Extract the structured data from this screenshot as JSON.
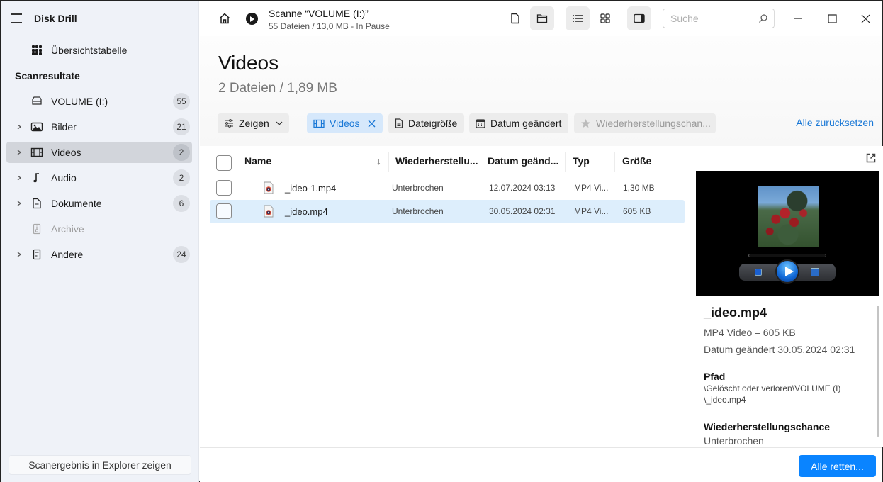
{
  "app": {
    "title": "Disk Drill"
  },
  "sidebar": {
    "overview_label": "Übersichtstabelle",
    "section_label": "Scanresultate",
    "items": [
      {
        "label": "VOLUME (I:)",
        "count": "55",
        "icon": "drive-icon",
        "expandable": false
      },
      {
        "label": "Bilder",
        "count": "21",
        "icon": "image-icon",
        "expandable": true
      },
      {
        "label": "Videos",
        "count": "2",
        "icon": "film-icon",
        "expandable": true,
        "active": true
      },
      {
        "label": "Audio",
        "count": "2",
        "icon": "music-note-icon",
        "expandable": true
      },
      {
        "label": "Dokumente",
        "count": "6",
        "icon": "document-icon",
        "expandable": true
      },
      {
        "label": "Archive",
        "count": "",
        "icon": "archive-icon",
        "expandable": false,
        "disabled": true
      },
      {
        "label": "Andere",
        "count": "24",
        "icon": "other-file-icon",
        "expandable": true
      }
    ],
    "explorer_button": "Scanergebnis in Explorer zeigen"
  },
  "topbar": {
    "scan_title": "Scanne “VOLUME (I:)”",
    "scan_status": "55 Dateien / 13,0 MB - In Pause",
    "search_placeholder": "Suche"
  },
  "main": {
    "title": "Videos",
    "subtitle": "2 Dateien / 1,89 MB",
    "filters": {
      "show": "Zeigen",
      "videos": "Videos",
      "filesize": "Dateigröße",
      "date_modified": "Datum geändert",
      "recovery_chance": "Wiederherstellungschan..."
    },
    "reset_all": "Alle zurücksetzen"
  },
  "table": {
    "columns": [
      "Name",
      "Wiederherstellu...",
      "Datum geänd...",
      "Typ",
      "Größe"
    ],
    "sort_indicator": "↓",
    "rows": [
      {
        "name": "_ideo-1.mp4",
        "recovery": "Unterbrochen",
        "date": "12.07.2024 03:13",
        "type": "MP4 Vi...",
        "size": "1,30 MB",
        "selected": false
      },
      {
        "name": "_ideo.mp4",
        "recovery": "Unterbrochen",
        "date": "30.05.2024 02:31",
        "type": "MP4 Vi...",
        "size": "605 KB",
        "selected": true
      }
    ]
  },
  "preview": {
    "name": "_ideo.mp4",
    "type_size": "MP4 Video – 605 KB",
    "date": "Datum geändert 30.05.2024 02:31",
    "path_label": "Pfad",
    "path": "\\Gelöscht oder verloren\\VOLUME (I)\\_ideo.mp4",
    "path_line1": "\\Gelöscht oder verloren\\VOLUME (I)",
    "path_line2": "\\_ideo.mp4",
    "recovery_label": "Wiederherstellungschance",
    "recovery_value": "Unterbrochen"
  },
  "footer": {
    "save_all": "Alle retten..."
  },
  "colors": {
    "accent": "#0a84ff",
    "link": "#1a78d6",
    "selected_row": "#ddeefc",
    "active_chip": "#d6e8fb"
  }
}
